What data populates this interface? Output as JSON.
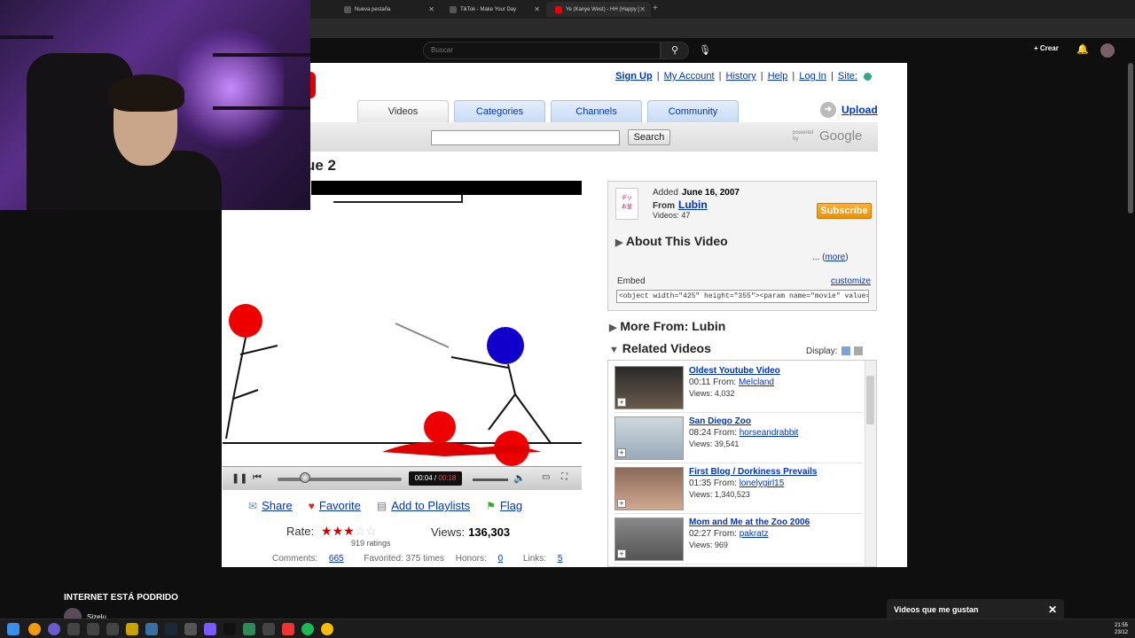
{
  "browser": {
    "tabs": [
      {
        "label": "Nueva pestaña"
      },
      {
        "label": "TikTok - Make Your Day"
      },
      {
        "label": "Ye (Kanye West) - HH (Happy ["
      }
    ]
  },
  "youtube": {
    "search_placeholder": "Buscar",
    "create_label": "Crear",
    "video_title": "INTERNET ESTÁ PODRIDO",
    "channel": "Sizelu",
    "liked_panel": "Videos que me gustan"
  },
  "old_yt": {
    "top_links": [
      "Sign Up",
      "My Account",
      "History",
      "Help",
      "Log In",
      "Site:"
    ],
    "nav_tabs": [
      "Videos",
      "Categories",
      "Channels",
      "Community"
    ],
    "upload_label": "Upload",
    "search_button": "Search",
    "powered_by": "powered by",
    "google": "Google",
    "title_fragment": "ue 2",
    "player": {
      "current_time": "00:04",
      "total_time": "00:18",
      "progress": 0.22
    },
    "actions": [
      "Share",
      "Favorite",
      "Add to Playlists",
      "Flag"
    ],
    "rate_label": "Rate:",
    "rating_stars": 3,
    "ratings_count": "919 ratings",
    "views_label": "Views:",
    "views_value": "136,303",
    "stats": {
      "comments_label": "Comments:",
      "comments": "665",
      "favorited": "Favorited: 375 times",
      "honors_label": "Honors:",
      "honors": "0",
      "links_label": "Links:",
      "links": "5"
    },
    "info": {
      "added_label": "Added",
      "added_date": "June 16, 2007",
      "from_label": "From",
      "from_user": "Lubin",
      "videos_count": "Videos: 47",
      "subscribe": "Subscribe",
      "about": "About This Video",
      "more_prefix": "... (",
      "more_link": "more",
      "more_suffix": ")",
      "embed_label": "Embed",
      "customize": "customize",
      "embed_code": "<object width=\"425\" height=\"355\"><param name=\"movie\" value=\"http://v"
    },
    "more_from": "More From: Lubin",
    "related_header": "Related Videos",
    "display_label": "Display:",
    "related": [
      {
        "title": "Oldest Youtube Video",
        "time": "00:11",
        "from": "Melcland",
        "views": "Views: 4,032"
      },
      {
        "title": "San Diego Zoo",
        "time": "08:24",
        "from": "horseandrabbit",
        "views": "Views: 39,541"
      },
      {
        "title": "First Blog / Dorkiness Prevails",
        "time": "01:35",
        "from": "lonelygirl15",
        "views": "Views: 1,340,523"
      },
      {
        "title": "Mom and Me at the Zoo 2006",
        "time": "02:27",
        "from": "pakratz",
        "views": "Views: 969"
      }
    ],
    "from_word": "From:"
  },
  "taskbar": {
    "time": "21:55",
    "date": "23/12"
  },
  "colors": {
    "accent": "#0033cc",
    "subscribe": "#f5a623",
    "stars": "#cc0000"
  }
}
